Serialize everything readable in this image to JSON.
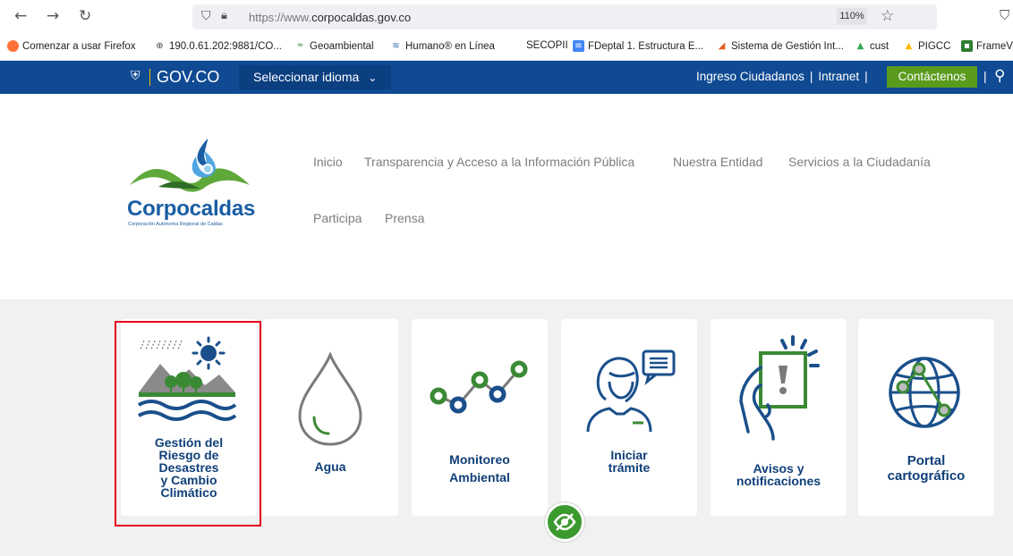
{
  "browser": {
    "url_prefix": "https://www.",
    "url_domain": "corpocaldas.gov.co",
    "zoom": "110%",
    "nav_icons": [
      "back-arrow",
      "forward-arrow",
      "reload",
      "shield",
      "lock",
      "star",
      "pocket"
    ]
  },
  "bookmarks": [
    {
      "label": "Comenzar a usar Firefox",
      "icon": "firefox-icon"
    },
    {
      "label": "190.0.61.202:9881/CO...",
      "icon": "globe-icon"
    },
    {
      "label": "Geoambiental",
      "icon": "geo-icon"
    },
    {
      "label": "Humano® en Línea",
      "icon": "humano-icon"
    },
    {
      "label": "SECOPII",
      "icon": "none"
    },
    {
      "label": "FDeptal 1. Estructura E...",
      "icon": "doc-icon"
    },
    {
      "label": "Sistema de Gestión Int...",
      "icon": "sg-icon"
    },
    {
      "label": "cust",
      "icon": "drive-icon"
    },
    {
      "label": "PIGCC",
      "icon": "drive-icon"
    },
    {
      "label": "FrameV",
      "icon": "frame-icon"
    }
  ],
  "govbar": {
    "logo": "GOV.CO",
    "language": "Seleccionar idioma",
    "link_ciudadanos": "Ingreso Ciudadanos",
    "link_intranet": "Intranet",
    "contact": "Contáctenos",
    "pipe": "|"
  },
  "brand": {
    "name": "Corpocaldas",
    "subtitle": "Corporación Autónoma Regional de Caldas"
  },
  "nav": [
    "Inicio",
    "Transparencia y Acceso a la Información Pública",
    "Nuestra Entidad",
    "Servicios a la Ciudadanía",
    "Participa",
    "Prensa"
  ],
  "tiles": [
    {
      "lines": [
        "Gestión del",
        "Riesgo de",
        "Desastres",
        "y Cambio",
        "Climático"
      ]
    },
    {
      "lines": [
        "Agua"
      ]
    },
    {
      "lines": [
        "Monitoreo",
        "Ambiental"
      ]
    },
    {
      "lines": [
        "Iniciar",
        "trámite"
      ]
    },
    {
      "lines": [
        "Avisos y",
        "notificaciones"
      ]
    },
    {
      "lines": [
        "Portal",
        "cartográfico"
      ]
    }
  ],
  "colors": {
    "gov_blue": "#0f4a93",
    "contact_green": "#5a9b1e",
    "tile_text": "#0f3f78",
    "icon_green": "#3a8a35",
    "icon_blue": "#1a4f8b",
    "highlight_red": "#e3001b"
  }
}
